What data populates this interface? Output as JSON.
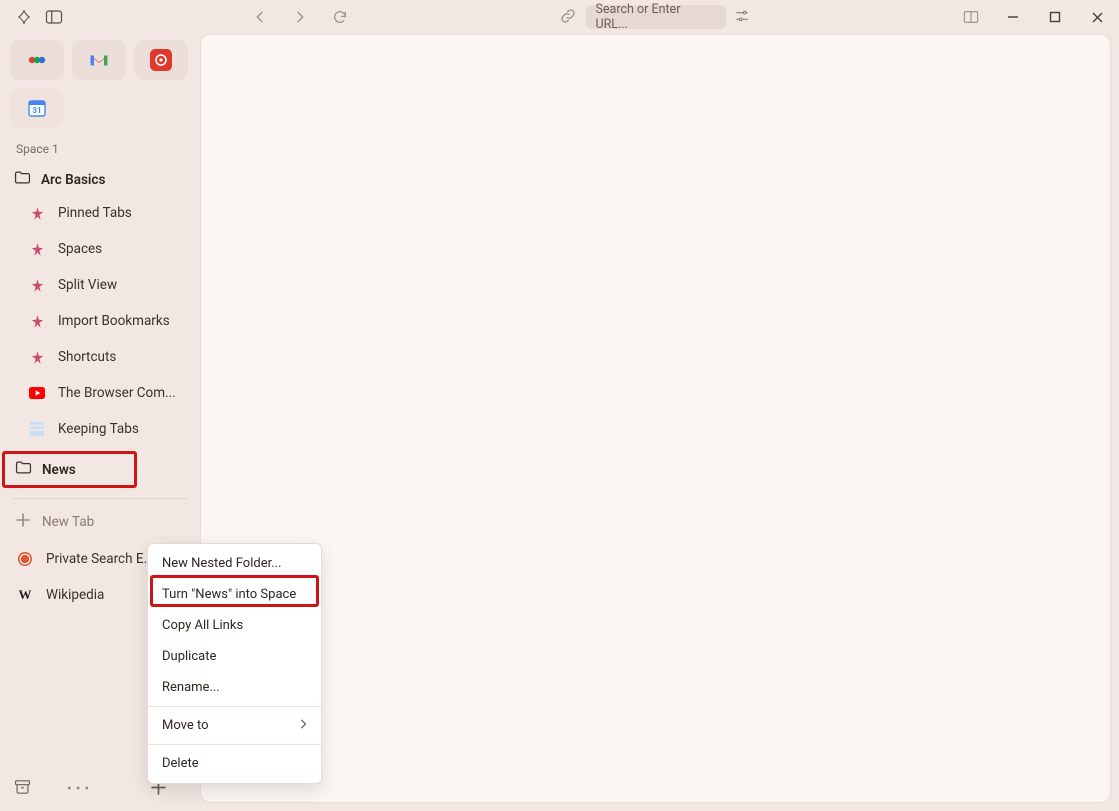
{
  "toolbar": {
    "search_placeholder": "Search or Enter URL..."
  },
  "sidebar": {
    "space_label": "Space 1",
    "folder_arc_basics": "Arc Basics",
    "items": [
      {
        "label": "Pinned Tabs",
        "icon": "arc"
      },
      {
        "label": "Spaces",
        "icon": "arc"
      },
      {
        "label": "Split View",
        "icon": "arc"
      },
      {
        "label": "Import Bookmarks",
        "icon": "arc"
      },
      {
        "label": "Shortcuts",
        "icon": "arc"
      },
      {
        "label": "The Browser Com...",
        "icon": "youtube"
      },
      {
        "label": "Keeping Tabs",
        "icon": "substack"
      }
    ],
    "news_folder": "News",
    "new_tab": "New Tab",
    "extra_tabs": [
      {
        "label": "Private Search E...",
        "icon": "duck"
      },
      {
        "label": "Wikipedia",
        "icon": "wiki"
      }
    ]
  },
  "context_menu": {
    "items": [
      "New Nested Folder...",
      "Turn \"News\" into Space",
      "Copy All Links",
      "Duplicate",
      "Rename...",
      "Move to",
      "Delete"
    ]
  }
}
